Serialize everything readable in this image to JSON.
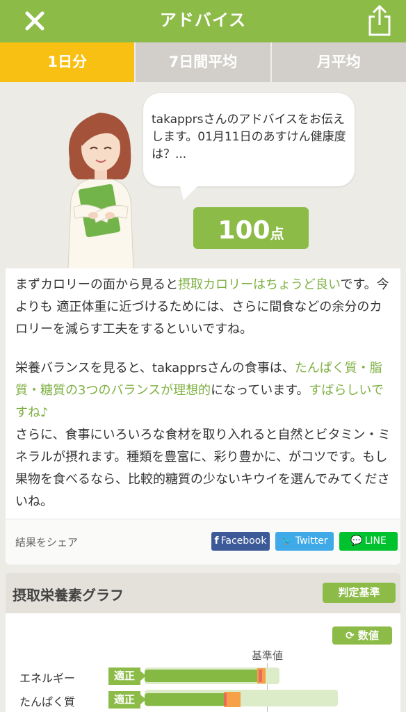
{
  "header": {
    "title": "アドバイス",
    "close_icon": "close-icon",
    "share_icon": "share-icon"
  },
  "tabs": [
    {
      "label": "1日分",
      "active": true
    },
    {
      "label": "7日間平均",
      "active": false
    },
    {
      "label": "月平均",
      "active": false
    }
  ],
  "advisor": {
    "message": "takapprsさんのアドバイスをお伝えします。01月11日のあすけん健康度は？...",
    "score": "100",
    "score_unit": "点"
  },
  "advice": {
    "p1_a": "まずカロリーの面から見ると",
    "p1_hl": "摂取カロリーはちょうど良い",
    "p1_b": "です。今よりも 適正体重に近づけるためには、さらに間食などの余分のカロリーを減らす工夫をするといいですね。",
    "p2_a": "栄養バランスを見ると、takapprsさんの食事は、",
    "p2_hl": "たんぱく質・脂質・糖質の3つのバランスが理想的",
    "p2_b": "になっています。",
    "p2_hl2": "すばらしいですね♪",
    "p3": "さらに、食事にいろいろな食材を取り入れると自然とビタミン・ミネラルが摂れます。種類を豊富に、彩り豊かに、がコツです。もし果物を食べるなら、比較的糖質の少ないキウイを選んでみてくださいね。"
  },
  "share": {
    "label": "結果をシェア",
    "facebook": "Facebook",
    "twitter": "Twitter",
    "line": "LINE"
  },
  "graph": {
    "title": "摂取栄養素グラフ",
    "judge_button": "判定基準",
    "value_button": "数値",
    "reference_label": "基準値",
    "rows": [
      {
        "label": "エネルギー",
        "status": "適正"
      },
      {
        "label": "たんぱく質",
        "status": "適正"
      }
    ]
  },
  "colors": {
    "brand_green": "#8cbb48",
    "active_tab": "#f8c012",
    "facebook": "#3d5a98",
    "twitter": "#40a9e8",
    "line": "#00c22e"
  }
}
